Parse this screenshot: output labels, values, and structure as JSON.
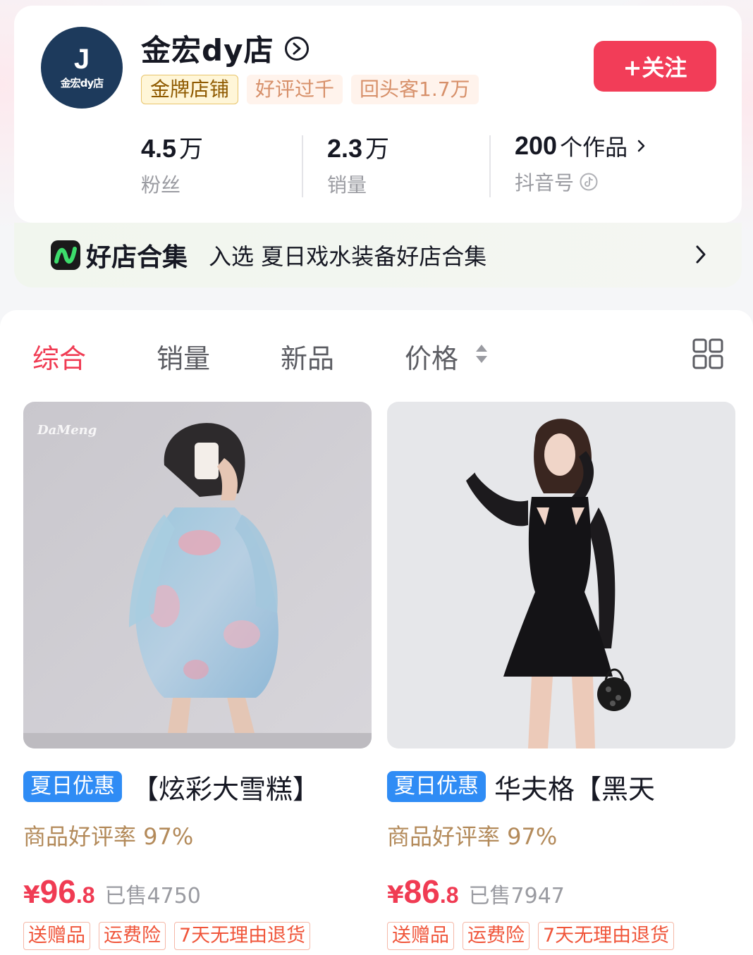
{
  "shop": {
    "avatar_letter": "J",
    "avatar_name": "金宏dy店",
    "name": "金宏dy店",
    "tags": [
      "金牌店铺",
      "好评过千",
      "回头客1.7万"
    ],
    "follow_label": "+关注",
    "stats": {
      "fans_value": "4.5",
      "fans_unit": "万",
      "fans_label": "粉丝",
      "sales_value": "2.3",
      "sales_unit": "万",
      "sales_label": "销量",
      "works_value": "200",
      "works_unit": "个作品",
      "works_label": "抖音号"
    }
  },
  "banner": {
    "title": "好店合集",
    "description": "入选 夏日戏水装备好店合集"
  },
  "sort": {
    "tabs": [
      "综合",
      "销量",
      "新品",
      "价格"
    ],
    "active": "综合"
  },
  "products": [
    {
      "badge": "夏日优惠",
      "title": "【炫彩大雪糕】",
      "rating": "商品好评率 97%",
      "currency": "¥",
      "price_int": "96",
      "price_dec": ".8",
      "sold": "已售4750",
      "services": [
        "送赠品",
        "运费险",
        "7天无理由退货"
      ],
      "watermark": "DaMeng"
    },
    {
      "badge": "夏日优惠",
      "title": "华夫格【黑天",
      "rating": "商品好评率 97%",
      "currency": "¥",
      "price_int": "86",
      "price_dec": ".8",
      "sold": "已售7947",
      "services": [
        "送赠品",
        "运费险",
        "7天无理由退货"
      ]
    }
  ],
  "colors": {
    "accent": "#f23d58",
    "badge_blue": "#2f8cf5",
    "gold_tag": "#8f5a00",
    "rating": "#b38a5a"
  }
}
